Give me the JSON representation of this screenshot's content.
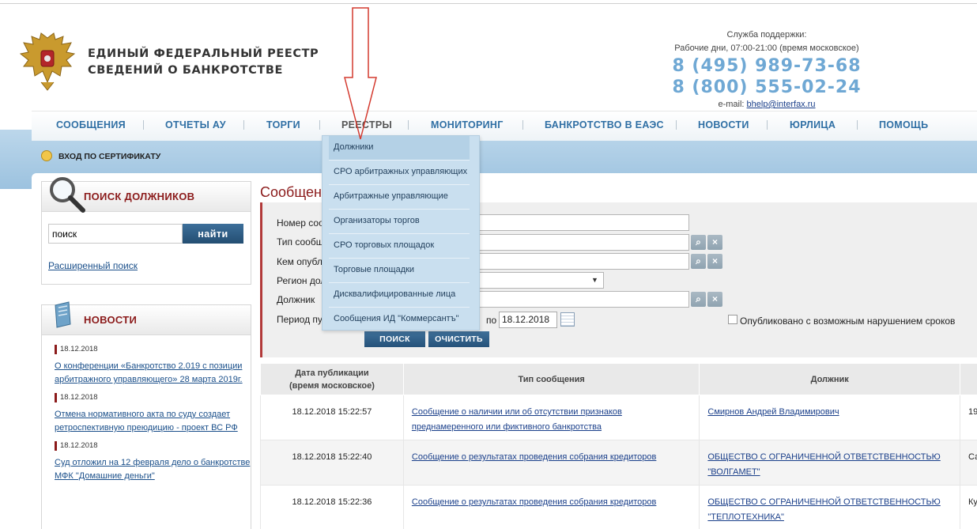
{
  "header": {
    "title_line1": "ЕДИНЫЙ  ФЕДЕРАЛЬНЫЙ  РЕЕСТР",
    "title_line2": "СВЕДЕНИЙ О БАНКРОТСТВЕ",
    "support_label": "Служба поддержки:",
    "support_hours": "Рабочие дни, 07:00-21:00 (время московское)",
    "phone1": "8 (495) 989-73-68",
    "phone2": "8 (800) 555-02-24",
    "email_label": "e-mail:",
    "email": "bhelp@interfax.ru"
  },
  "nav": {
    "items": [
      "СООБЩЕНИЯ",
      "ОТЧЕТЫ АУ",
      "ТОРГИ",
      "РЕЕСТРЫ",
      "МОНИТОРИНГ",
      "БАНКРОТСТВО В ЕАЭС",
      "НОВОСТИ",
      "ЮРЛИЦА",
      "ПОМОЩЬ"
    ]
  },
  "cert_login": "ВХОД ПО СЕРТИФИКАТУ",
  "dropdown": {
    "items": [
      "Должники",
      "СРО арбитражных управляющих",
      "Арбитражные управляющие",
      "Организаторы торгов",
      "СРО торговых площадок",
      "Торговые площадки",
      "Дисквалифицированные лица",
      "Сообщения ИД \"Коммерсантъ\""
    ]
  },
  "debtor_search": {
    "title": "ПОИСК ДОЛЖНИКОВ",
    "input_value": "поиск",
    "button": "найти",
    "advanced_link": "Расширенный поиск"
  },
  "news": {
    "title": "НОВОСТИ",
    "items": [
      {
        "date": "18.12.2018",
        "text": "О конференции «Банкротство 2.019 с позиции арбитражного управляющего» 28 марта 2019г."
      },
      {
        "date": "18.12.2018",
        "text": "Отмена нормативного акта по суду создает ретроспективную преюдицию - проект ВС РФ"
      },
      {
        "date": "18.12.2018",
        "text": "Суд отложил на 12 февраля дело о банкротстве МФК \"Домашние деньги\""
      }
    ]
  },
  "main": {
    "title": "Сообщени",
    "labels": {
      "number": "Номер сооб",
      "type": "Тип сообщ",
      "published_by": "Кем опубл",
      "region": "Регион дол",
      "debtor": "Должник",
      "period": "Период пу"
    },
    "period_to_label": "по",
    "period_to_value": "18.12.2018",
    "checkbox_label": "Опубликовано с возможным нарушением сроков",
    "search_button": "ПОИСК",
    "clear_button": "ОЧИСТИТЬ"
  },
  "table": {
    "headers": [
      "Дата публикации (время московское)",
      "Тип сообщения",
      "Должник",
      ""
    ],
    "rows": [
      {
        "date": "18.12.2018 15:22:57",
        "type": "Сообщение о наличии или об отсутствии признаков преднамеренного или фиктивного банкротства",
        "debtor": "Смирнов Андрей Владимирович",
        "extra": "19"
      },
      {
        "date": "18.12.2018 15:22:40",
        "type": "Сообщение о результатах проведения собрания кредиторов",
        "debtor": "ОБЩЕСТВО С ОГРАНИЧЕННОЙ ОТВЕТСТВЕННОСТЬЮ \"ВОЛГАМЕТ\"",
        "extra": "Са"
      },
      {
        "date": "18.12.2018 15:22:36",
        "type": "Сообщение о результатах проведения собрания кредиторов",
        "debtor": "ОБЩЕСТВО С ОГРАНИЧЕННОЙ ОТВЕТСТВЕННОСТЬЮ \"ТЕПЛОТЕХНИКА\"",
        "extra": "Ку"
      }
    ]
  },
  "colors": {
    "nav_text": "#2f6fa4",
    "accent_red": "#8b1a1a",
    "phone": "#6fa8d4",
    "bluebar": "#a9cae3",
    "dropdown_bg": "#c9dfef"
  },
  "icons": {
    "logo": "russian-coat-of-arms-icon",
    "magnifier": "magnifier-icon",
    "news": "newspaper-icon",
    "lock": "lock-icon",
    "lookup": "lookup-icon",
    "clear": "clear-x-icon",
    "calendar": "calendar-icon",
    "annotation_arrow": "down-arrow-icon"
  }
}
